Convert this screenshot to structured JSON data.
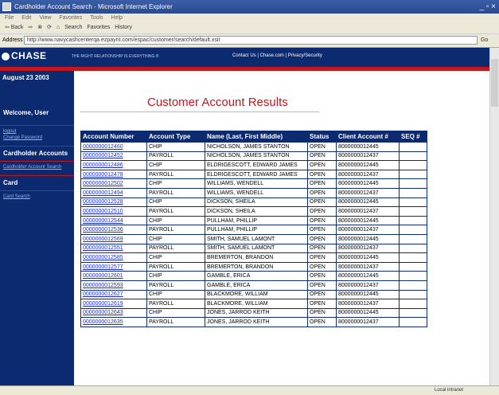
{
  "browser": {
    "title": "Cardholder Account Search - Microsoft Internet Explorer",
    "window_controls": "_ ▫ ×",
    "menu": [
      "File",
      "Edit",
      "View",
      "Favorites",
      "Tools",
      "Help"
    ],
    "toolbar": [
      "⇦ Back",
      "⇨",
      "⊗",
      "⟳",
      "⌂",
      "Search",
      "Favorites",
      "History"
    ],
    "address_label": "Address",
    "address_value": "http://www.navycashcenterqa.ezpaynt.com/espac/customer/search/default.xsit",
    "go_label": "Go",
    "status_zone": "Local intranet"
  },
  "site": {
    "logo_text": "CHASE",
    "tagline": "THE RIGHT RELATIONSHIP IS EVERYTHING.®",
    "top_links": "Contact Us   |   Chase.com   |   Privacy/Security",
    "date": "August 23 2003"
  },
  "sidebar": {
    "welcome": "Welcome, User",
    "logout": "logout",
    "change_password": "Change Password",
    "section1": "Cardholder Accounts",
    "section1_link": "Cardholder Account Search",
    "section2": "Card",
    "section2_link": "Card Search"
  },
  "main": {
    "title": "Customer Account Results"
  },
  "table": {
    "headers": [
      "Account Number",
      "Account Type",
      "Name (Last, First Middle)",
      "Status",
      "Client Account #",
      "SEQ #"
    ],
    "rows": [
      [
        "0000000012460",
        "CHIP",
        "NICHOLSON, JAMES STANTON",
        "OPEN",
        "8000000012445",
        ""
      ],
      [
        "0000000012452",
        "PAYROLL",
        "NICHOLSON, JAMES STANTON",
        "OPEN",
        "8000000012437",
        ""
      ],
      [
        "0000000012486",
        "CHIP",
        "ELDRIGESCOTT, EDWARD JAMES",
        "OPEN",
        "8000000012445",
        ""
      ],
      [
        "0000000012478",
        "PAYROLL",
        "ELDRIGESCOTT, EDWARD JAMES",
        "OPEN",
        "8000000012437",
        ""
      ],
      [
        "0000000012502",
        "CHIP",
        "WILLIAMS, WENDELL",
        "OPEN",
        "8000000012445",
        ""
      ],
      [
        "0000000012494",
        "PAYROLL",
        "WILLIAMS, WENDELL",
        "OPEN",
        "8000000012437",
        ""
      ],
      [
        "0000000012528",
        "CHIP",
        "DICKSON, SHEILA",
        "OPEN",
        "8000000012445",
        ""
      ],
      [
        "0000000012510",
        "PAYROLL",
        "DICKSON, SHEILA",
        "OPEN",
        "8000000012437",
        ""
      ],
      [
        "0000000012544",
        "CHIP",
        "PULLHAM, PHILLIP",
        "OPEN",
        "8000000012445",
        ""
      ],
      [
        "0000000012536",
        "PAYROLL",
        "PULLHAM, PHILLIP",
        "OPEN",
        "8000000012437",
        ""
      ],
      [
        "0000000012569",
        "CHIP",
        "SMITH, SAMUEL LAMONT",
        "OPEN",
        "8000000012445",
        ""
      ],
      [
        "0000000012551",
        "PAYROLL",
        "SMITH, SAMUEL LAMONT",
        "OPEN",
        "8000000012437",
        ""
      ],
      [
        "0000000012585",
        "CHIP",
        "BREMERTON, BRANDON",
        "OPEN",
        "8000000012445",
        ""
      ],
      [
        "0000000012577",
        "PAYROLL",
        "BREMERTON, BRANDON",
        "OPEN",
        "8000000012437",
        ""
      ],
      [
        "0000000012601",
        "CHIP",
        "GAMBLE, ERICA",
        "OPEN",
        "8000000012445",
        ""
      ],
      [
        "0000000012593",
        "PAYROLL",
        "GAMBLE, ERICA",
        "OPEN",
        "8000000012437",
        ""
      ],
      [
        "0000000012627",
        "CHIP",
        "BLACKMORE, WILLIAM",
        "OPEN",
        "8000000012445",
        ""
      ],
      [
        "0000000012619",
        "PAYROLL",
        "BLACKMORE, WILLIAM",
        "OPEN",
        "8000000012437",
        ""
      ],
      [
        "0000000012643",
        "CHIP",
        "JONES, JARROD KEITH",
        "OPEN",
        "8000000012445",
        ""
      ],
      [
        "0000000012635",
        "PAYROLL",
        "JONES, JARROD KEITH",
        "OPEN",
        "8000000012437",
        ""
      ]
    ]
  },
  "colors": {
    "chase_blue": "#0b2a6f",
    "chase_red": "#c5161d",
    "link_blue": "#1a2bd6"
  }
}
